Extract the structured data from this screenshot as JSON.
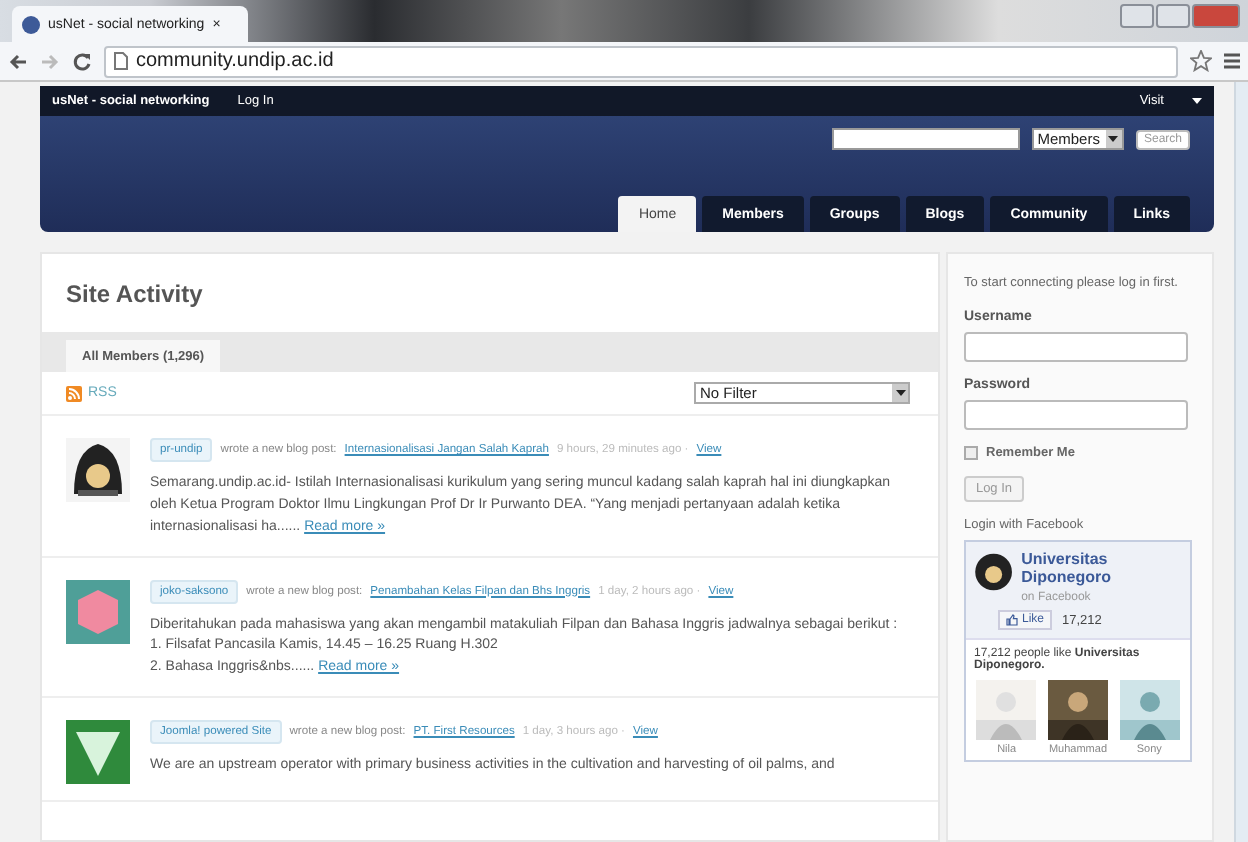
{
  "browser": {
    "tab_title": "usNet - social networking",
    "tab_close": "×",
    "url": "community.undip.ac.id"
  },
  "topbar": {
    "site_name": "usNet - social networking",
    "login": "Log In",
    "visit": "Visit"
  },
  "search": {
    "scope": "Members",
    "button": "Search"
  },
  "nav": [
    {
      "label": "Home",
      "selected": true
    },
    {
      "label": "Members",
      "selected": false
    },
    {
      "label": "Groups",
      "selected": false
    },
    {
      "label": "Blogs",
      "selected": false
    },
    {
      "label": "Community",
      "selected": false
    },
    {
      "label": "Links",
      "selected": false
    }
  ],
  "main": {
    "title": "Site Activity",
    "tabs": [
      {
        "label": "All Members (1,296)",
        "selected": true
      }
    ],
    "rss": "RSS",
    "filter": "No Filter",
    "activity": [
      {
        "kind": "emblem",
        "user": "pr-undip",
        "action": "wrote a new blog post:",
        "post": "Internasionalisasi Jangan Salah Kaprah",
        "time": "9 hours, 29 minutes ago ·",
        "view": "View",
        "body": [
          "Semarang.undip.ac.id- Istilah Internasionalisasi kurikulum yang sering muncul kadang salah kaprah hal ini diungkapkan oleh Ketua Program Doktor Ilmu Lingkungan Prof Dr Ir Purwanto DEA.  “Yang menjadi pertanyaan adalah ketika internasionalisasi ha......"
        ],
        "read_more": "Read more »"
      },
      {
        "kind": "hexagon",
        "user": "joko-saksono",
        "action": "wrote a new blog post:",
        "post": "Penambahan Kelas Filpan dan Bhs Inggris",
        "time": "1 day, 2 hours ago ·",
        "view": "View",
        "body": [
          "Diberitahukan pada mahasiswa yang akan mengambil matakuliah Filpan dan Bahasa Inggris jadwalnya sebagai berikut :",
          "1. Filsafat Pancasila   Kamis, 14.45 – 16.25         Ruang H.302",
          "2. Bahasa Inggris&nbs......"
        ],
        "read_more": "Read more »"
      },
      {
        "kind": "triangle",
        "user": "Joomla! powered Site",
        "action": "wrote a new blog post:",
        "post": "PT. First Resources",
        "time": "1 day, 3 hours ago ·",
        "view": "View",
        "body": [
          "We are an upstream operator with primary business activities in the cultivation and harvesting of oil palms, and"
        ]
      }
    ]
  },
  "sidebar": {
    "intro": "To start connecting please log in first.",
    "username_label": "Username",
    "password_label": "Password",
    "remember": {
      "label": "Remember Me",
      "checked": false
    },
    "login_button": "Log In",
    "facebook_heading": "Login with Facebook",
    "facebook": {
      "page_name": "Universitas Diponegoro",
      "on": "on",
      "site": "Facebook",
      "like": "Like",
      "like_count": "17,212",
      "people_line": "17,212 people like **Universitas Diponegoro.**",
      "fans": [
        {
          "name": "Nila"
        },
        {
          "name": "Muhammad"
        },
        {
          "name": "Sony"
        }
      ]
    }
  }
}
